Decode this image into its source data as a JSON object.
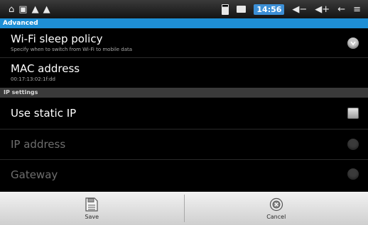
{
  "statusbar": {
    "time": "14:56",
    "left_icons": [
      "home-icon",
      "notification-icon",
      "warning-icon",
      "warning-icon"
    ],
    "right_icons": [
      "battery-icon",
      "image-icon",
      "volume-down-icon",
      "volume-up-icon",
      "back-icon",
      "menu-icon"
    ]
  },
  "header": {
    "title": "Advanced"
  },
  "settings": {
    "wifi_sleep": {
      "title": "Wi-Fi sleep policy",
      "summary": "Specify when to switch from Wi-Fi to mobile data"
    },
    "mac": {
      "title": "MAC address",
      "summary": "00:17:13:02:1f:dd"
    }
  },
  "ip_section": {
    "title": "IP settings"
  },
  "ip_settings": {
    "static_ip": {
      "title": "Use static IP",
      "checked": false
    },
    "ip_address": {
      "title": "IP address"
    },
    "gateway": {
      "title": "Gateway"
    }
  },
  "bottombar": {
    "save_label": "Save",
    "cancel_label": "Cancel"
  },
  "colors": {
    "accent": "#1e8fd6",
    "clock_bg": "#3c8fd6"
  }
}
